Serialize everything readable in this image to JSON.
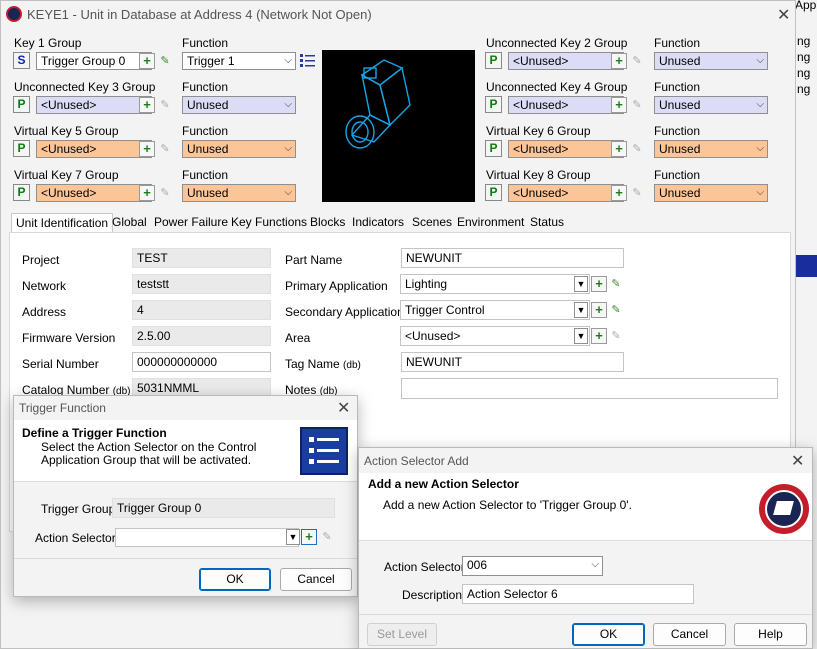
{
  "main": {
    "title": "KEYE1 - Unit in Database at Address 4 (Network Not Open)",
    "keys_left": [
      {
        "group_label": "Key 1 Group",
        "letter": "S",
        "group_value": "Trigger Group 0",
        "function_label": "Function",
        "function_value": "Trigger 1",
        "color": "white"
      },
      {
        "group_label": "Unconnected Key 3 Group",
        "letter": "P",
        "group_value": "<Unused>",
        "function_label": "Function",
        "function_value": "Unused",
        "color": "blue"
      },
      {
        "group_label": "Virtual Key 5 Group",
        "letter": "P",
        "group_value": "<Unused>",
        "function_label": "Function",
        "function_value": "Unused",
        "color": "orange"
      },
      {
        "group_label": "Virtual Key 7 Group",
        "letter": "P",
        "group_value": "<Unused>",
        "function_label": "Function",
        "function_value": "Unused",
        "color": "orange"
      }
    ],
    "keys_right": [
      {
        "group_label": "Unconnected Key 2 Group",
        "letter": "P",
        "group_value": "<Unused>",
        "function_label": "Function",
        "function_value": "Unused",
        "color": "blue"
      },
      {
        "group_label": "Unconnected Key 4 Group",
        "letter": "P",
        "group_value": "<Unused>",
        "function_label": "Function",
        "function_value": "Unused",
        "color": "blue"
      },
      {
        "group_label": "Virtual Key 6 Group",
        "letter": "P",
        "group_value": "<Unused>",
        "function_label": "Function",
        "function_value": "Unused",
        "color": "orange"
      },
      {
        "group_label": "Virtual Key 8 Group",
        "letter": "P",
        "group_value": "<Unused>",
        "function_label": "Function",
        "function_value": "Unused",
        "color": "orange"
      }
    ],
    "tabs": [
      "Unit Identification",
      "Global",
      "Power Failure",
      "Key Functions",
      "Blocks",
      "Indicators",
      "Scenes",
      "Environment",
      "Status"
    ],
    "left_fields": [
      {
        "label": "Project",
        "value": "TEST"
      },
      {
        "label": "Network",
        "value": "teststt"
      },
      {
        "label": "Address",
        "value": "4"
      },
      {
        "label": "Firmware Version",
        "value": "2.5.00"
      },
      {
        "label": "Serial Number",
        "value": "000000000000"
      },
      {
        "label": "Catalog Number",
        "suffix": "(db)",
        "value": "5031NMML"
      }
    ],
    "right_fields": [
      {
        "label": "Part Name",
        "value": "NEWUNIT"
      },
      {
        "label": "Primary Application",
        "value": "Lighting"
      },
      {
        "label": "Secondary Application",
        "value": "Trigger Control"
      },
      {
        "label": "Area",
        "value": "<Unused>"
      },
      {
        "label": "Tag Name",
        "suffix": "(db)",
        "value": "NEWUNIT"
      },
      {
        "label": "Notes",
        "suffix": "(db)",
        "value": ""
      }
    ]
  },
  "background_window": {
    "title_fragment": "Appli",
    "list_fragments": [
      "ng",
      "ng",
      "ng",
      "ng"
    ]
  },
  "trigger_dialog": {
    "title": "Trigger Function",
    "heading": "Define a Trigger Function",
    "description": "Select the Action Selector on the Control Application Group that will be activated.",
    "trigger_group_label": "Trigger Group",
    "trigger_group_value": "Trigger Group 0",
    "action_selector_label": "Action Selector",
    "action_selector_value": "",
    "ok": "OK",
    "cancel": "Cancel"
  },
  "add_dialog": {
    "title": "Action Selector Add",
    "heading": "Add a new Action Selector",
    "description": "Add a new Action Selector to 'Trigger Group 0'.",
    "action_selector_label": "Action Selector",
    "action_selector_value": "006",
    "description_label": "Description",
    "description_value": "Action Selector 6",
    "set_level": "Set Level",
    "ok": "OK",
    "cancel": "Cancel",
    "help": "Help"
  }
}
